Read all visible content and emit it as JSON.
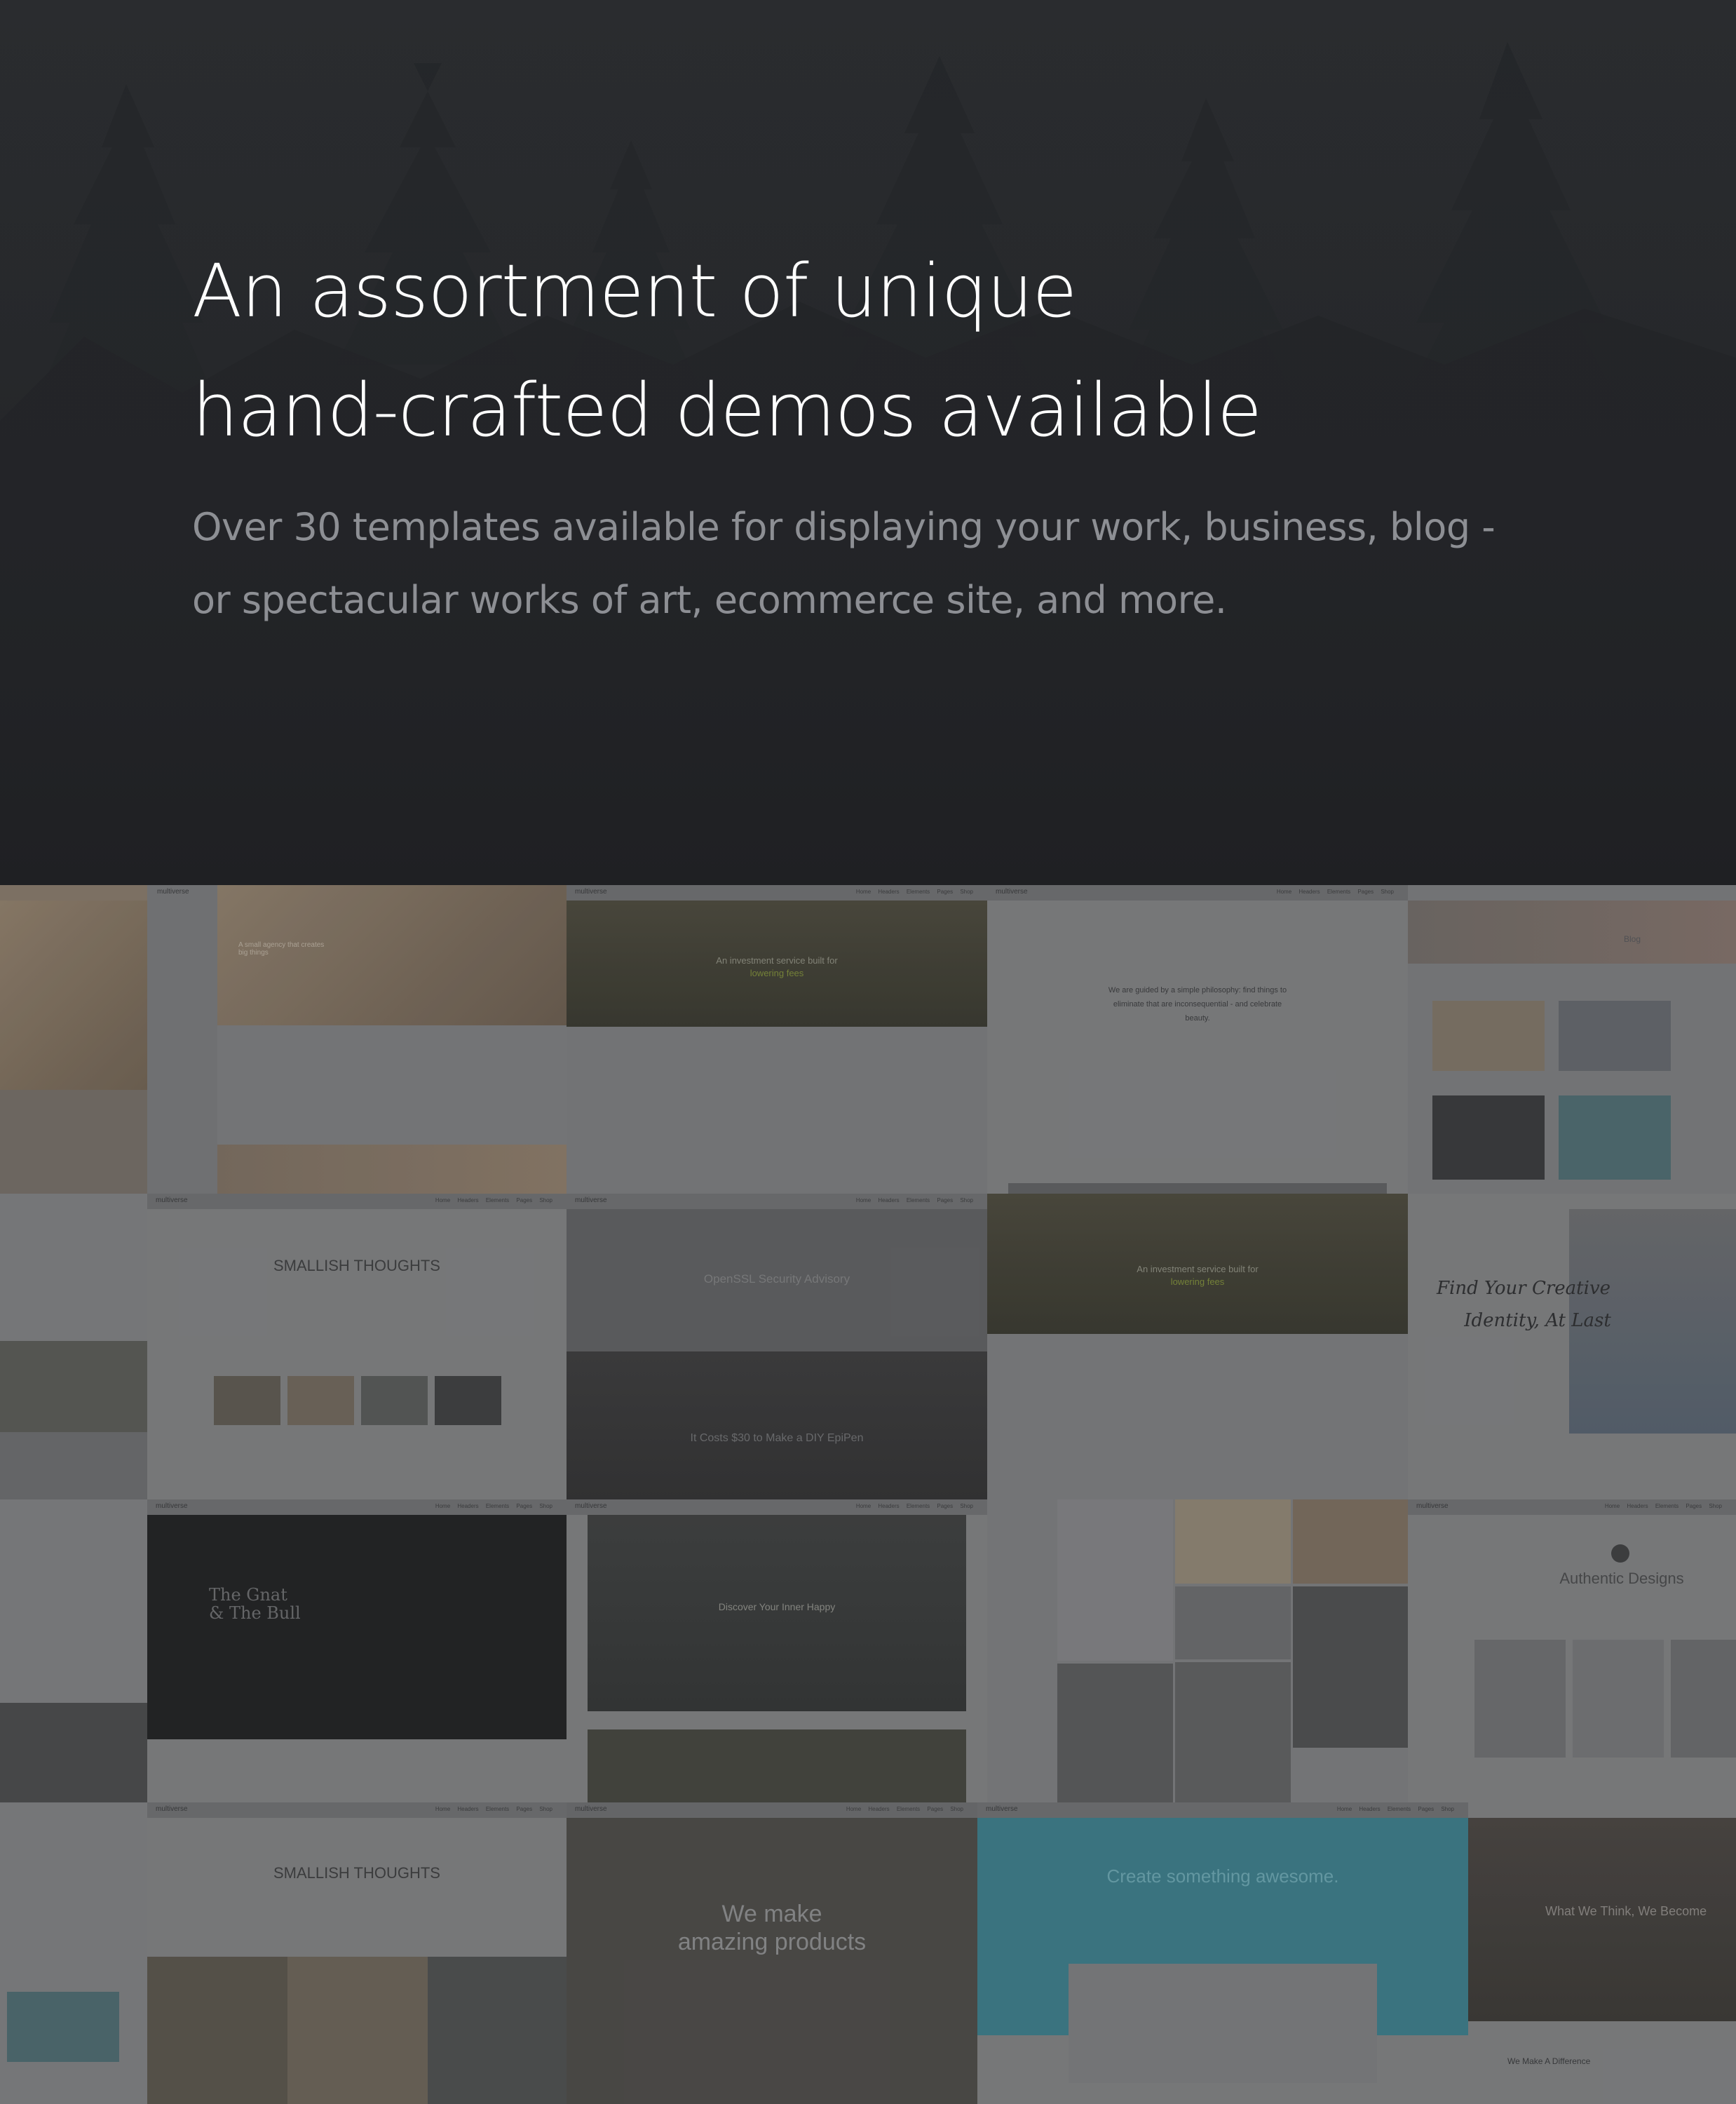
{
  "hero": {
    "title_line1": "An assortment of unique",
    "title_line2": "hand-crafted demos available",
    "subtitle_line1": "Over 30 templates available for displaying your work, business, blog -",
    "subtitle_line2": "or spectacular works of art, ecommerce site, and more."
  },
  "demos": {
    "logo": "multiverse",
    "nav": "Home Headers Elements Pages Shop",
    "tiles": {
      "investment_1": "An investment service built for",
      "investment_1b": "lowering fees",
      "philosophy": "We are guided by a simple philosophy: find things to eliminate that are inconsequential - and celebrate beauty.",
      "smallish_1": "SMALLISH THOUGHTS",
      "openssl": "OpenSSL Security Advisory",
      "epipen": "It Costs $30 to Make a DIY EpiPen",
      "investment_2": "An investment service built for",
      "investment_2b": "lowering fees",
      "creative_1": "Find Your Creative",
      "creative_2": "Identity, At Last",
      "gnat_1": "The Gnat",
      "gnat_2": "& The Bull",
      "inner_happy": "Discover Your Inner Happy",
      "authentic": "Authentic Designs",
      "smallish_2": "SMALLISH THOUGHTS",
      "products_1": "We make",
      "products_2": "amazing products",
      "awesome": "Create something awesome.",
      "think": "What We Think, We Become",
      "difference": "We Make A Difference",
      "small_agency": "A small agency that creates big things",
      "blog": "Blog"
    }
  }
}
